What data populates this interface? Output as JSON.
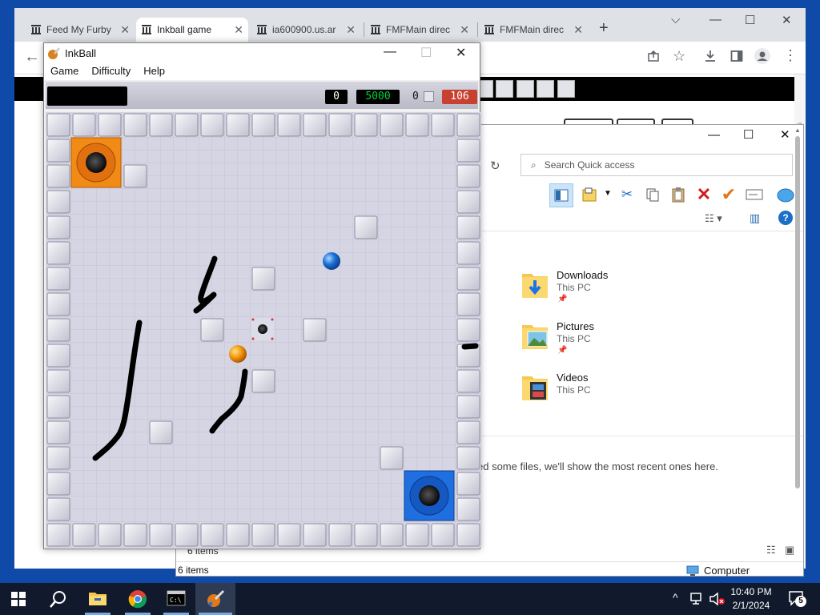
{
  "browser": {
    "tabs": [
      {
        "label": "Feed My Furby",
        "active": false
      },
      {
        "label": "Inkball game",
        "active": true
      },
      {
        "label": "ia600900.us.ar",
        "active": false
      },
      {
        "label": "FMFMain direc",
        "active": false
      },
      {
        "label": "FMFMain direc",
        "active": false
      }
    ],
    "new_tab": "+",
    "controls": {
      "dropdown": "⌵",
      "minimize": "—",
      "maximize": "☐",
      "close": "✕"
    }
  },
  "explorer": {
    "search_placeholder": "Search Quick access",
    "folders": [
      {
        "name": "Downloads",
        "sub": "This PC"
      },
      {
        "name": "Pictures",
        "sub": "This PC"
      },
      {
        "name": "Videos",
        "sub": "This PC"
      }
    ],
    "recent_message": "ed some files, we'll show the most recent ones here.",
    "status_items": "6 items",
    "status_items_bottom": "6 items",
    "status_location": "Computer"
  },
  "inkball": {
    "title": "InkBall",
    "menu": [
      "Game",
      "Difficulty",
      "Help"
    ],
    "score": "0",
    "bonus": "5000",
    "balls_count": "0",
    "time_left": "106",
    "counter_colors": {
      "bonus": "#00d13a",
      "time": "#c8402f"
    }
  },
  "taskbar": {
    "time": "10:40 PM",
    "date": "2/1/2024",
    "notifications": "5"
  }
}
